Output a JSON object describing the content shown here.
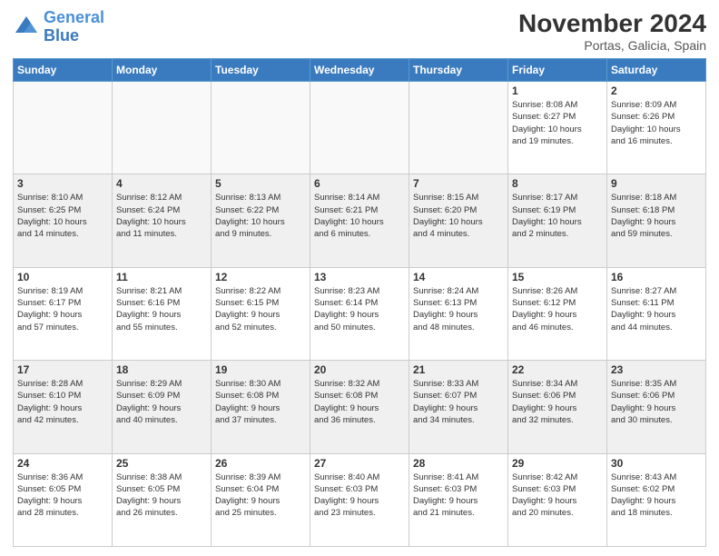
{
  "header": {
    "logo_line1": "General",
    "logo_line2": "Blue",
    "month": "November 2024",
    "location": "Portas, Galicia, Spain"
  },
  "weekdays": [
    "Sunday",
    "Monday",
    "Tuesday",
    "Wednesday",
    "Thursday",
    "Friday",
    "Saturday"
  ],
  "weeks": [
    [
      {
        "day": "",
        "info": "",
        "empty": true
      },
      {
        "day": "",
        "info": "",
        "empty": true
      },
      {
        "day": "",
        "info": "",
        "empty": true
      },
      {
        "day": "",
        "info": "",
        "empty": true
      },
      {
        "day": "",
        "info": "",
        "empty": true
      },
      {
        "day": "1",
        "info": "Sunrise: 8:08 AM\nSunset: 6:27 PM\nDaylight: 10 hours\nand 19 minutes.",
        "empty": false
      },
      {
        "day": "2",
        "info": "Sunrise: 8:09 AM\nSunset: 6:26 PM\nDaylight: 10 hours\nand 16 minutes.",
        "empty": false
      }
    ],
    [
      {
        "day": "3",
        "info": "Sunrise: 8:10 AM\nSunset: 6:25 PM\nDaylight: 10 hours\nand 14 minutes.",
        "empty": false
      },
      {
        "day": "4",
        "info": "Sunrise: 8:12 AM\nSunset: 6:24 PM\nDaylight: 10 hours\nand 11 minutes.",
        "empty": false
      },
      {
        "day": "5",
        "info": "Sunrise: 8:13 AM\nSunset: 6:22 PM\nDaylight: 10 hours\nand 9 minutes.",
        "empty": false
      },
      {
        "day": "6",
        "info": "Sunrise: 8:14 AM\nSunset: 6:21 PM\nDaylight: 10 hours\nand 6 minutes.",
        "empty": false
      },
      {
        "day": "7",
        "info": "Sunrise: 8:15 AM\nSunset: 6:20 PM\nDaylight: 10 hours\nand 4 minutes.",
        "empty": false
      },
      {
        "day": "8",
        "info": "Sunrise: 8:17 AM\nSunset: 6:19 PM\nDaylight: 10 hours\nand 2 minutes.",
        "empty": false
      },
      {
        "day": "9",
        "info": "Sunrise: 8:18 AM\nSunset: 6:18 PM\nDaylight: 9 hours\nand 59 minutes.",
        "empty": false
      }
    ],
    [
      {
        "day": "10",
        "info": "Sunrise: 8:19 AM\nSunset: 6:17 PM\nDaylight: 9 hours\nand 57 minutes.",
        "empty": false
      },
      {
        "day": "11",
        "info": "Sunrise: 8:21 AM\nSunset: 6:16 PM\nDaylight: 9 hours\nand 55 minutes.",
        "empty": false
      },
      {
        "day": "12",
        "info": "Sunrise: 8:22 AM\nSunset: 6:15 PM\nDaylight: 9 hours\nand 52 minutes.",
        "empty": false
      },
      {
        "day": "13",
        "info": "Sunrise: 8:23 AM\nSunset: 6:14 PM\nDaylight: 9 hours\nand 50 minutes.",
        "empty": false
      },
      {
        "day": "14",
        "info": "Sunrise: 8:24 AM\nSunset: 6:13 PM\nDaylight: 9 hours\nand 48 minutes.",
        "empty": false
      },
      {
        "day": "15",
        "info": "Sunrise: 8:26 AM\nSunset: 6:12 PM\nDaylight: 9 hours\nand 46 minutes.",
        "empty": false
      },
      {
        "day": "16",
        "info": "Sunrise: 8:27 AM\nSunset: 6:11 PM\nDaylight: 9 hours\nand 44 minutes.",
        "empty": false
      }
    ],
    [
      {
        "day": "17",
        "info": "Sunrise: 8:28 AM\nSunset: 6:10 PM\nDaylight: 9 hours\nand 42 minutes.",
        "empty": false
      },
      {
        "day": "18",
        "info": "Sunrise: 8:29 AM\nSunset: 6:09 PM\nDaylight: 9 hours\nand 40 minutes.",
        "empty": false
      },
      {
        "day": "19",
        "info": "Sunrise: 8:30 AM\nSunset: 6:08 PM\nDaylight: 9 hours\nand 37 minutes.",
        "empty": false
      },
      {
        "day": "20",
        "info": "Sunrise: 8:32 AM\nSunset: 6:08 PM\nDaylight: 9 hours\nand 36 minutes.",
        "empty": false
      },
      {
        "day": "21",
        "info": "Sunrise: 8:33 AM\nSunset: 6:07 PM\nDaylight: 9 hours\nand 34 minutes.",
        "empty": false
      },
      {
        "day": "22",
        "info": "Sunrise: 8:34 AM\nSunset: 6:06 PM\nDaylight: 9 hours\nand 32 minutes.",
        "empty": false
      },
      {
        "day": "23",
        "info": "Sunrise: 8:35 AM\nSunset: 6:06 PM\nDaylight: 9 hours\nand 30 minutes.",
        "empty": false
      }
    ],
    [
      {
        "day": "24",
        "info": "Sunrise: 8:36 AM\nSunset: 6:05 PM\nDaylight: 9 hours\nand 28 minutes.",
        "empty": false
      },
      {
        "day": "25",
        "info": "Sunrise: 8:38 AM\nSunset: 6:05 PM\nDaylight: 9 hours\nand 26 minutes.",
        "empty": false
      },
      {
        "day": "26",
        "info": "Sunrise: 8:39 AM\nSunset: 6:04 PM\nDaylight: 9 hours\nand 25 minutes.",
        "empty": false
      },
      {
        "day": "27",
        "info": "Sunrise: 8:40 AM\nSunset: 6:03 PM\nDaylight: 9 hours\nand 23 minutes.",
        "empty": false
      },
      {
        "day": "28",
        "info": "Sunrise: 8:41 AM\nSunset: 6:03 PM\nDaylight: 9 hours\nand 21 minutes.",
        "empty": false
      },
      {
        "day": "29",
        "info": "Sunrise: 8:42 AM\nSunset: 6:03 PM\nDaylight: 9 hours\nand 20 minutes.",
        "empty": false
      },
      {
        "day": "30",
        "info": "Sunrise: 8:43 AM\nSunset: 6:02 PM\nDaylight: 9 hours\nand 18 minutes.",
        "empty": false
      }
    ]
  ]
}
